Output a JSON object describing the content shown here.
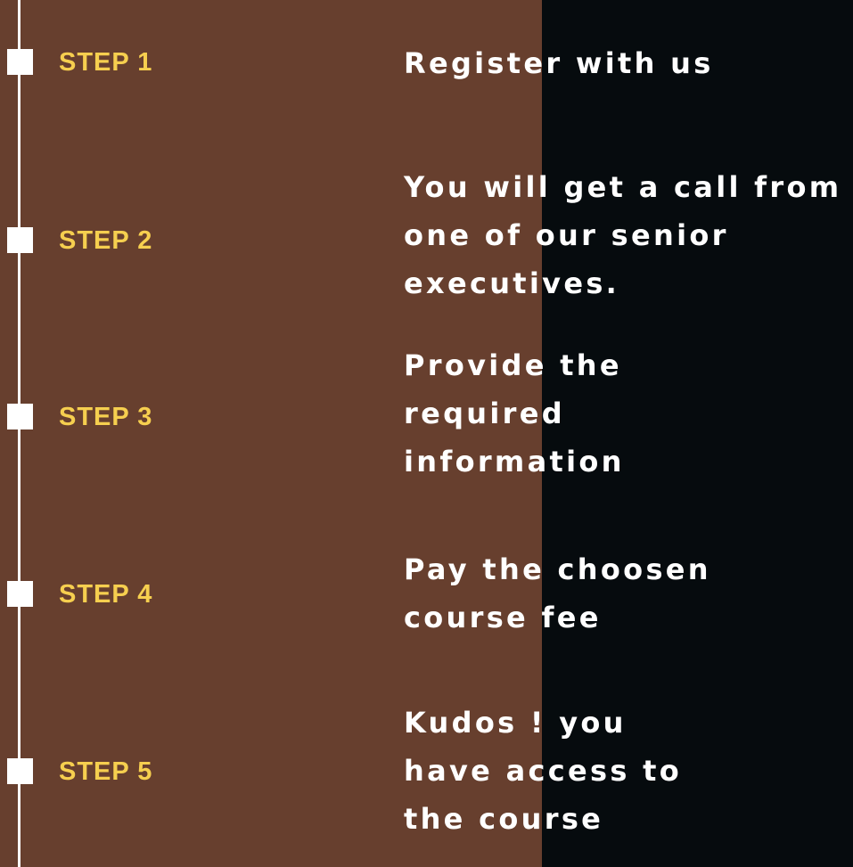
{
  "colors": {
    "brown_panel": "#673f2e",
    "dark_panel": "#060b0e",
    "step_label": "#f6cf4f",
    "text": "#ffffff",
    "timeline": "#ffffff"
  },
  "steps": [
    {
      "label": "STEP 1",
      "description": "Register with us"
    },
    {
      "label": "STEP 2",
      "description": "You will get a call from\none of our senior\nexecutives."
    },
    {
      "label": "STEP 3",
      "description": "Provide the\nrequired\ninformation"
    },
    {
      "label": "STEP 4",
      "description": "Pay the choosen\ncourse fee"
    },
    {
      "label": "STEP 5",
      "description": "Kudos ! you\nhave access to\nthe course"
    }
  ]
}
